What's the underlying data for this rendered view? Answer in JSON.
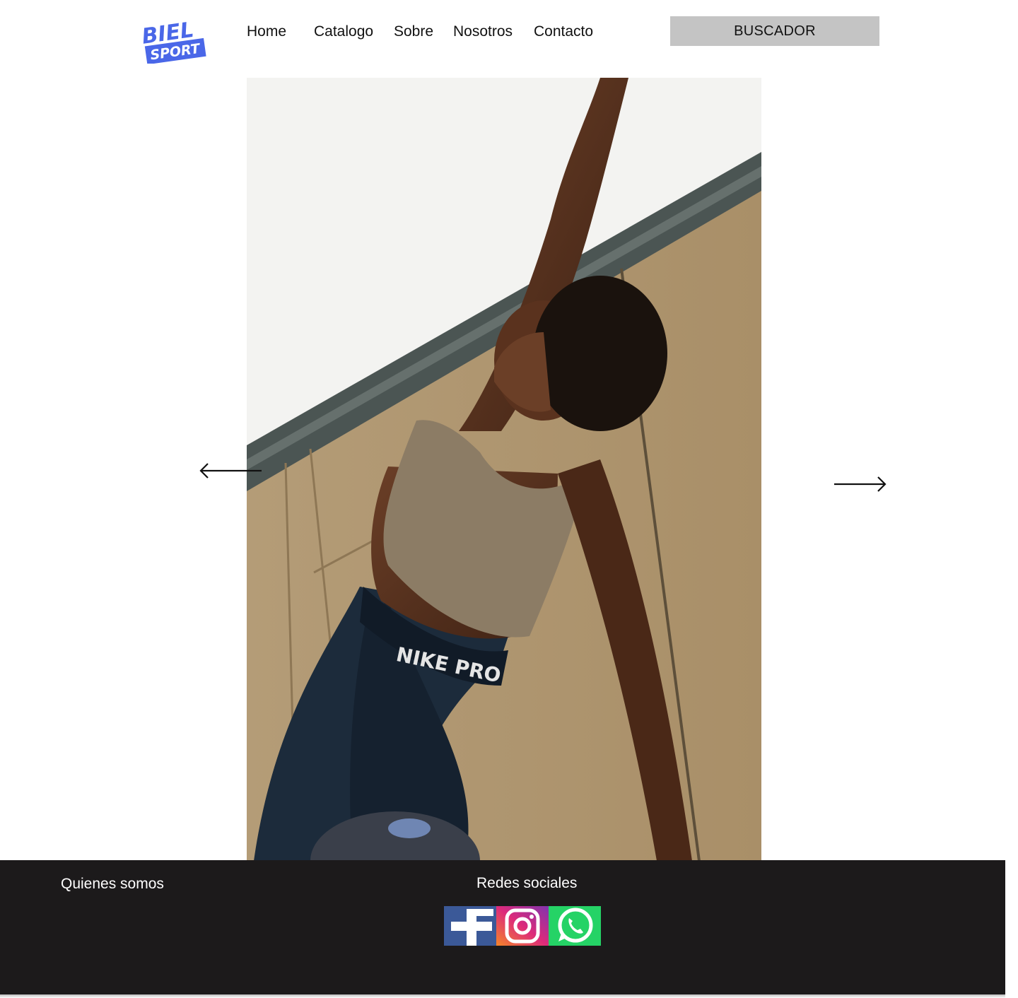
{
  "brand": {
    "logo_line1": "BIEL",
    "logo_line2": "SPORT",
    "logo_color": "#4a67e8"
  },
  "nav": {
    "items": [
      {
        "label": "Home"
      },
      {
        "label": "Catalogo"
      },
      {
        "label": "Sobre"
      },
      {
        "label": "Nosotros"
      },
      {
        "label": "Contacto"
      }
    ],
    "search_label": "BUSCADOR"
  },
  "carousel": {
    "image_icon": "athlete-stretching-photo",
    "prev_icon": "arrow-left-icon",
    "next_icon": "arrow-right-icon"
  },
  "footer": {
    "about_label": "Quienes somos",
    "social_title": "Redes sociales",
    "social": [
      {
        "icon": "facebook-icon",
        "color": "#3b5998"
      },
      {
        "icon": "instagram-icon",
        "color": "#e1306c"
      },
      {
        "icon": "whatsapp-icon",
        "color": "#25d366"
      }
    ],
    "background": "#1c1a1b"
  }
}
